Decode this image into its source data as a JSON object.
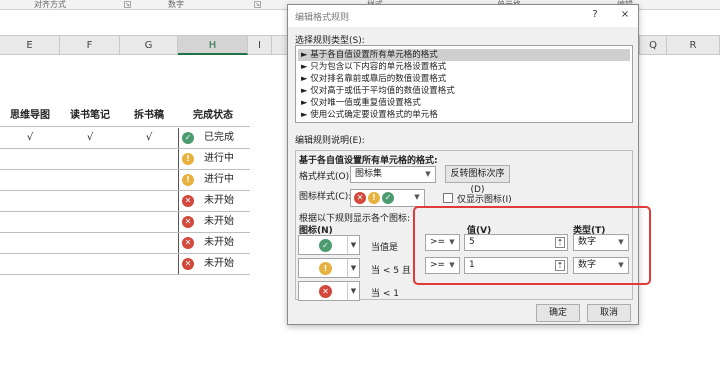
{
  "ribbon": {
    "items": [
      "对齐方式",
      "数字",
      "样式",
      "单元格",
      "编辑"
    ]
  },
  "sheet": {
    "columns": [
      "E",
      "F",
      "G",
      "H",
      "I",
      "Q",
      "R"
    ],
    "header_row": [
      "思维导图",
      "读书笔记",
      "拆书稿",
      "完成状态"
    ],
    "rows": [
      {
        "e": "√",
        "f": "√",
        "g": "√",
        "icon": "check",
        "status": "已完成"
      },
      {
        "e": "",
        "f": "",
        "g": "",
        "icon": "exclaim",
        "status": "进行中"
      },
      {
        "e": "",
        "f": "",
        "g": "",
        "icon": "exclaim",
        "status": "进行中"
      },
      {
        "e": "",
        "f": "",
        "g": "",
        "icon": "cross",
        "status": "未开始"
      },
      {
        "e": "",
        "f": "",
        "g": "",
        "icon": "cross",
        "status": "未开始"
      },
      {
        "e": "",
        "f": "",
        "g": "",
        "icon": "cross",
        "status": "未开始"
      },
      {
        "e": "",
        "f": "",
        "g": "",
        "icon": "cross",
        "status": "未开始"
      }
    ]
  },
  "dialog": {
    "title": "编辑格式规则",
    "help": "?",
    "close": "×",
    "select_rule_type_label": "选择规则类型(S):",
    "rule_types": [
      "► 基于各自值设置所有单元格的格式",
      "► 只为包含以下内容的单元格设置格式",
      "► 仅对排名靠前或靠后的数值设置格式",
      "► 仅对高于或低于平均值的数值设置格式",
      "► 仅对唯一值或重复值设置格式",
      "► 使用公式确定要设置格式的单元格"
    ],
    "edit_desc_label": "编辑规则说明(E):",
    "desc_heading": "基于各自值设置所有单元格的格式:",
    "format_style_label": "格式样式(O):",
    "format_style_value": "图标集",
    "reverse_button": "反转图标次序(D)",
    "icon_style_label": "图标样式(C):",
    "show_icon_only_label": "仅显示图标(I)",
    "rules_label": "根据以下规则显示各个图标:",
    "icon_col_label": "图标(N)",
    "value_col_label": "值(V)",
    "type_col_label": "类型(T)",
    "conditions": [
      {
        "icon": "check",
        "text": "当值是",
        "op": ">=",
        "value": "5",
        "type": "数字"
      },
      {
        "icon": "exclaim",
        "text": "当 < 5 且",
        "op": ">=",
        "value": "1",
        "type": "数字"
      },
      {
        "icon": "cross",
        "text": "当 < 1",
        "op": "",
        "value": "",
        "type": ""
      }
    ],
    "ok_button": "确定",
    "cancel_button": "取消"
  },
  "colors": {
    "green": "#4b9b6e",
    "yellow": "#e7b13f",
    "red": "#d2483b",
    "highlight_box": "#e03a3a"
  }
}
